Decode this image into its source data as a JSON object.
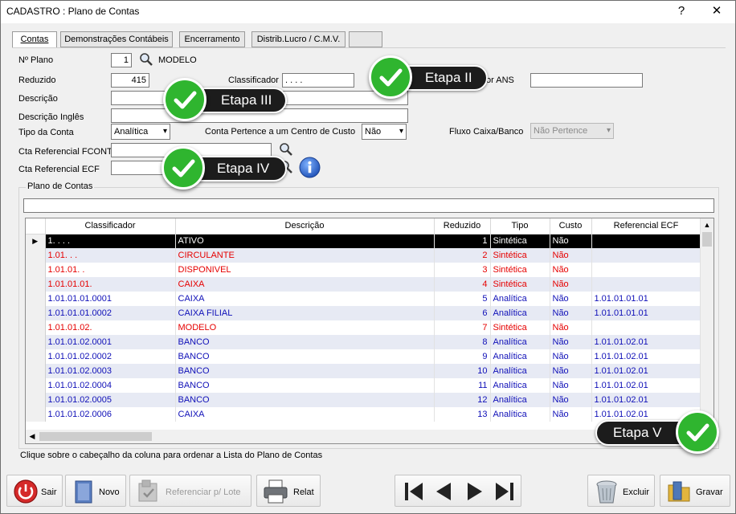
{
  "window": {
    "title": "CADASTRO : Plano de Contas",
    "help_label": "?",
    "close_label": "✕"
  },
  "tabs": [
    {
      "label": "Contas",
      "active": true
    },
    {
      "label": "Demonstrações Contábeis",
      "active": false
    },
    {
      "label": "Encerramento",
      "active": false
    },
    {
      "label": "Distrib.Lucro / C.M.V.",
      "active": false
    },
    {
      "label": "",
      "active": false
    }
  ],
  "form": {
    "plano_label": "Nº Plano",
    "plano_value": "1",
    "plano_name": "MODELO",
    "reduzido_label": "Reduzido",
    "reduzido_value": "415",
    "classificador_label": "Classificador",
    "classificador_value": ". . . .",
    "ans_label": "or ANS",
    "ans_value": "",
    "descricao_label": "Descrição",
    "descricao_value": "",
    "descricao_ingles_label": "Descrição Inglês",
    "descricao_ingles_value": "",
    "tipo_conta_label": "Tipo da Conta",
    "tipo_conta_value": "Analítica",
    "centro_custo_label": "Conta Pertence a um Centro de Custo",
    "centro_custo_value": "Não",
    "fluxo_caixa_label": "Fluxo Caixa/Banco",
    "fluxo_caixa_value": "Não Pertence",
    "cta_fcont_label": "Cta Referencial FCONT",
    "cta_fcont_value": "",
    "cta_ecf_label": "Cta Referencial ECF",
    "cta_ecf_value": ""
  },
  "grid": {
    "group_title": "Plano de Contas",
    "filter_value": "",
    "columns": [
      "Classificador",
      "Descrição",
      "Reduzido",
      "Tipo",
      "Custo",
      "Referencial ECF"
    ],
    "rows": [
      {
        "classificador": "1. . . .",
        "descricao": "ATIVO",
        "reduzido": "1",
        "tipo": "Sintética",
        "custo": "Não",
        "ref": "",
        "color": "sel"
      },
      {
        "classificador": "1.01. . .",
        "descricao": "CIRCULANTE",
        "reduzido": "2",
        "tipo": "Sintética",
        "custo": "Não",
        "ref": "",
        "color": "red"
      },
      {
        "classificador": "1.01.01. .",
        "descricao": "DISPONIVEL",
        "reduzido": "3",
        "tipo": "Sintética",
        "custo": "Não",
        "ref": "",
        "color": "red"
      },
      {
        "classificador": "1.01.01.01.",
        "descricao": "CAIXA",
        "reduzido": "4",
        "tipo": "Sintética",
        "custo": "Não",
        "ref": "",
        "color": "red"
      },
      {
        "classificador": "1.01.01.01.0001",
        "descricao": "CAIXA",
        "reduzido": "5",
        "tipo": "Analítica",
        "custo": "Não",
        "ref": "1.01.01.01.01",
        "color": "blue"
      },
      {
        "classificador": "1.01.01.01.0002",
        "descricao": "CAIXA FILIAL",
        "reduzido": "6",
        "tipo": "Analítica",
        "custo": "Não",
        "ref": "1.01.01.01.01",
        "color": "blue"
      },
      {
        "classificador": "1.01.01.02.",
        "descricao": "MODELO",
        "reduzido": "7",
        "tipo": "Sintética",
        "custo": "Não",
        "ref": "",
        "color": "red"
      },
      {
        "classificador": "1.01.01.02.0001",
        "descricao": "BANCO",
        "reduzido": "8",
        "tipo": "Analítica",
        "custo": "Não",
        "ref": "1.01.01.02.01",
        "color": "blue"
      },
      {
        "classificador": "1.01.01.02.0002",
        "descricao": "BANCO",
        "reduzido": "9",
        "tipo": "Analítica",
        "custo": "Não",
        "ref": "1.01.01.02.01",
        "color": "blue"
      },
      {
        "classificador": "1.01.01.02.0003",
        "descricao": "BANCO",
        "reduzido": "10",
        "tipo": "Analítica",
        "custo": "Não",
        "ref": "1.01.01.02.01",
        "color": "blue"
      },
      {
        "classificador": "1.01.01.02.0004",
        "descricao": "BANCO",
        "reduzido": "11",
        "tipo": "Analítica",
        "custo": "Não",
        "ref": "1.01.01.02.01",
        "color": "blue"
      },
      {
        "classificador": "1.01.01.02.0005",
        "descricao": "BANCO",
        "reduzido": "12",
        "tipo": "Analítica",
        "custo": "Não",
        "ref": "1.01.01.02.01",
        "color": "blue"
      },
      {
        "classificador": "1.01.01.02.0006",
        "descricao": "CAIXA",
        "reduzido": "13",
        "tipo": "Analítica",
        "custo": "Não",
        "ref": "1.01.01.02.01",
        "color": "blue"
      }
    ],
    "status_text": "Clique sobre o cabeçalho da coluna para ordenar a Lista do Plano de Contas"
  },
  "toolbar": {
    "sair_label": "Sair",
    "novo_label": "Novo",
    "referenciar_label": "Referenciar p/ Lote",
    "relat_label": "Relat",
    "excluir_label": "Excluir",
    "gravar_label": "Gravar"
  },
  "callouts": {
    "etapa2": "Etapa II",
    "etapa3": "Etapa III",
    "etapa4": "Etapa IV",
    "etapa5": "Etapa V"
  },
  "colors": {
    "red_rows": "#e60000",
    "blue_rows": "#1010b8",
    "callout_green": "#2fb52f",
    "callout_dark": "#1c1c1c"
  }
}
